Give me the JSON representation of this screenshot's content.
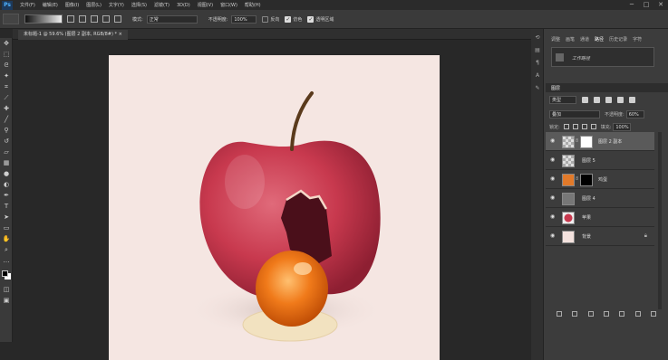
{
  "menu": {
    "logo": "Ps",
    "items": [
      "文件(F)",
      "编辑(E)",
      "图像(I)",
      "图层(L)",
      "文字(Y)",
      "选择(S)",
      "滤镜(T)",
      "3D(D)",
      "视图(V)",
      "窗口(W)",
      "帮助(H)"
    ]
  },
  "window_controls": {
    "minimize": "─",
    "maximize": "□",
    "close": "✕"
  },
  "options": {
    "mode_label": "模式:",
    "mode_value": "正常",
    "opacity_label": "不透明度:",
    "opacity_value": "100%",
    "reverse_label": "反向",
    "dither_label": "仿色",
    "transparency_label": "透明区域",
    "reverse_checked": false,
    "dither_checked": true,
    "transparency_checked": true
  },
  "document": {
    "tab_title": "未标题-1 @ 59.6% (图层 2 副本, RGB/8#) *  ×"
  },
  "toolbar": {
    "tools": [
      "move-icon",
      "marquee-icon",
      "lasso-icon",
      "magic-wand-icon",
      "crop-icon",
      "eyedropper-icon",
      "healing-icon",
      "brush-icon",
      "stamp-icon",
      "history-brush-icon",
      "eraser-icon",
      "gradient-icon",
      "blur-icon",
      "dodge-icon",
      "pen-icon",
      "type-icon",
      "path-select-icon",
      "shape-icon",
      "hand-icon",
      "zoom-icon",
      "more-icon"
    ]
  },
  "panels": {
    "tabs": [
      "调整",
      "画笔",
      "通道",
      "路径",
      "历史记录",
      "字符"
    ],
    "active_tab": "路径",
    "history_item": "工作路径"
  },
  "layers": {
    "title": "图层",
    "filter": "类型",
    "blend_mode": "叠加",
    "opacity_label": "不透明度:",
    "opacity_value": "60%",
    "lock_label": "锁定:",
    "fill_label": "填充:",
    "fill_value": "100%",
    "items": [
      {
        "name": "图层 2 副本",
        "selected": true,
        "visible": true,
        "has_mask": true,
        "thumb": "#bdbdbd"
      },
      {
        "name": "图层 5",
        "selected": false,
        "visible": true,
        "has_mask": false,
        "thumb": "#d9d9d9"
      },
      {
        "name": "鸡蛋",
        "selected": false,
        "visible": true,
        "has_mask": true,
        "thumb": "#e27a2a"
      },
      {
        "name": "图层 4",
        "selected": false,
        "visible": true,
        "has_mask": false,
        "thumb": "#777777"
      },
      {
        "name": "苹果",
        "selected": false,
        "visible": true,
        "has_mask": false,
        "thumb": "#b8283c"
      },
      {
        "name": "背景",
        "selected": false,
        "visible": true,
        "has_mask": false,
        "thumb": "#f4e2de",
        "locked": true
      }
    ]
  },
  "colors": {
    "canvas_bg": "#f5e6e2",
    "apple": "#c8394e",
    "yolk": "#f07a1a",
    "ui_dark": "#282828",
    "ui_panel": "#3c3c3c"
  }
}
